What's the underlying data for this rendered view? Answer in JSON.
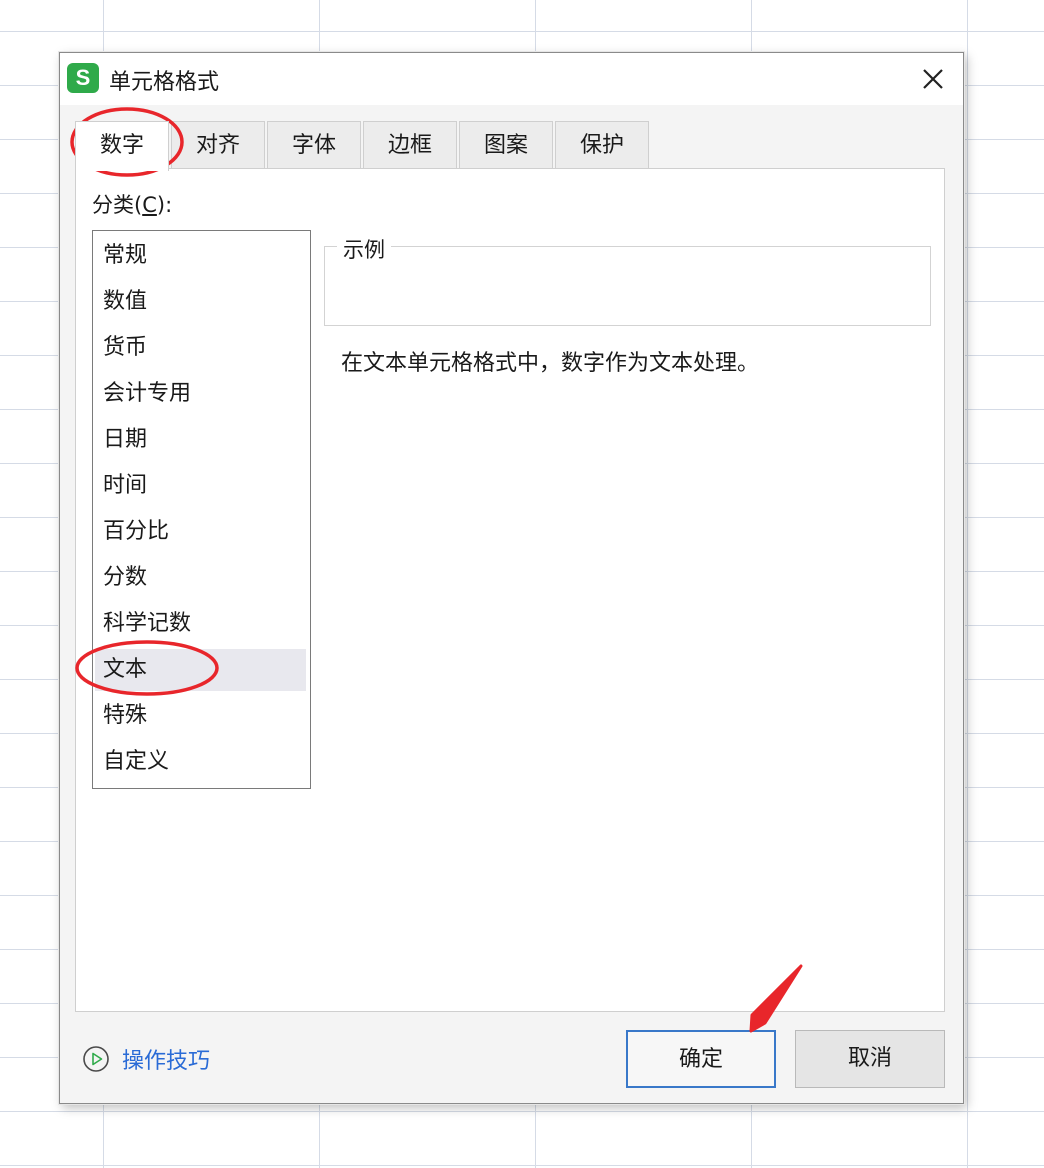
{
  "dialog": {
    "title": "单元格格式",
    "app_icon_letter": "S",
    "tabs": [
      {
        "label": "数字",
        "active": true
      },
      {
        "label": "对齐",
        "active": false
      },
      {
        "label": "字体",
        "active": false
      },
      {
        "label": "边框",
        "active": false
      },
      {
        "label": "图案",
        "active": false
      },
      {
        "label": "保护",
        "active": false
      }
    ],
    "category_label_prefix": "分类(",
    "category_label_key": "C",
    "category_label_suffix": "):",
    "categories": [
      {
        "label": "常规"
      },
      {
        "label": "数值"
      },
      {
        "label": "货币"
      },
      {
        "label": "会计专用"
      },
      {
        "label": "日期"
      },
      {
        "label": "时间"
      },
      {
        "label": "百分比"
      },
      {
        "label": "分数"
      },
      {
        "label": "科学记数"
      },
      {
        "label": "文本",
        "selected": true
      },
      {
        "label": "特殊"
      },
      {
        "label": "自定义"
      }
    ],
    "sample_label": "示例",
    "description": "在文本单元格格式中，数字作为文本处理。",
    "tips_label": "操作技巧",
    "ok_label": "确定",
    "cancel_label": "取消"
  },
  "colors": {
    "accent_blue": "#3978c9",
    "link_blue": "#2a6bd6",
    "app_icon_green": "#2faa4a",
    "annotation_red": "#e8262b"
  }
}
